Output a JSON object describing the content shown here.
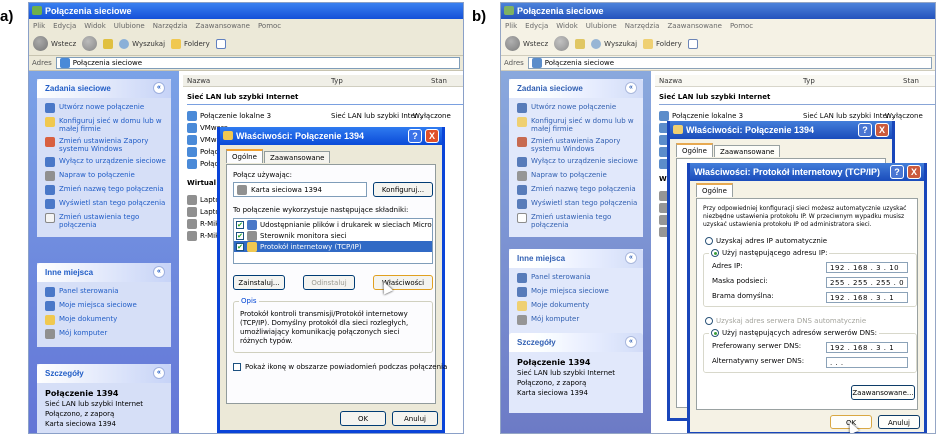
{
  "figure": {
    "panel_a_label": "a)",
    "panel_b_label": "b)"
  },
  "window": {
    "title": "Połączenia sieciowe",
    "menu": [
      "Plik",
      "Edycja",
      "Widok",
      "Ulubione",
      "Narzędzia",
      "Zaawansowane",
      "Pomoc"
    ],
    "toolbar": {
      "back": "Wstecz",
      "search": "Wyszukaj",
      "folders": "Foldery"
    },
    "address_label": "Adres",
    "address_value": "Połączenia sieciowe"
  },
  "sidebar": {
    "tasks": {
      "title": "Zadania sieciowe",
      "items": [
        {
          "label": "Utwórz nowe połączenie",
          "icon": "new-connection-icon"
        },
        {
          "label": "Konfiguruj sieć w domu lub w małej firmie",
          "icon": "home-network-icon"
        },
        {
          "label": "Zmień ustawienia Zapory systemu Windows",
          "icon": "firewall-icon"
        },
        {
          "label": "Wyłącz to urządzenie sieciowe",
          "icon": "disable-device-icon"
        },
        {
          "label": "Napraw to połączenie",
          "icon": "repair-icon"
        },
        {
          "label": "Zmień nazwę tego połączenia",
          "icon": "rename-icon"
        },
        {
          "label": "Wyświetl stan tego połączenia",
          "icon": "status-icon"
        },
        {
          "label": "Zmień ustawienia tego połączenia",
          "icon": "settings-icon"
        }
      ]
    },
    "places": {
      "title": "Inne miejsca",
      "items": [
        {
          "label": "Panel sterowania",
          "icon": "control-panel-icon"
        },
        {
          "label": "Moje miejsca sieciowe",
          "icon": "network-places-icon"
        },
        {
          "label": "Moje dokumenty",
          "icon": "documents-icon"
        },
        {
          "label": "Mój komputer",
          "icon": "computer-icon"
        }
      ]
    },
    "details": {
      "title": "Szczegóły",
      "name": "Połączenie 1394",
      "lines": [
        "Sieć LAN lub szybki Internet",
        "Połączono, z zaporą",
        "Karta sieciowa 1394"
      ]
    }
  },
  "list": {
    "columns": [
      "Nazwa",
      "Typ",
      "Stan"
    ],
    "group1": "Sieć LAN lub szybki Internet",
    "rows1": [
      {
        "name": "Połączenie lokalne 3",
        "type": "Sieć LAN lub szybki Inter...",
        "status": "Wyłączone"
      },
      {
        "name": "VMware...",
        "type": "",
        "status": ""
      },
      {
        "name": "VMware...",
        "type": "",
        "status": ""
      },
      {
        "name": "Połącz...",
        "type": "",
        "status": ""
      },
      {
        "name": "Połącz...",
        "type": "",
        "status": ""
      }
    ],
    "group2": "Wirtual",
    "rows2": [
      "Laptop",
      "Laptop",
      "R-Mik",
      "R-Mik"
    ]
  },
  "props": {
    "title": "Właściwości: Połączenie 1394",
    "tabs": [
      "Ogólne",
      "Zaawansowane"
    ],
    "connect_using_label": "Połącz używając:",
    "adapter": "Karta sieciowa 1394",
    "configure_button": "Konfiguruj...",
    "components_label": "To połączenie wykorzystuje następujące składniki:",
    "components": [
      "Udostępnianie plików i drukarek w sieciach Microsoft N",
      "Sterownik monitora sieci",
      "Protokół internetowy (TCP/IP)"
    ],
    "install_button": "Zainstaluj...",
    "uninstall_button": "Odinstaluj",
    "properties_button": "Właściwości",
    "description_label": "Opis",
    "description": "Protokół kontroli transmisji/Protokół internetowy (TCP/IP). Domyślny protokół dla sieci rozległych, umożliwiający komunikację połączonych sieci różnych typów.",
    "show_icon_label": "Pokaż ikonę w obszarze powiadomień podczas połączenia",
    "ok": "OK",
    "cancel": "Anuluj"
  },
  "tcpip": {
    "title": "Właściwości: Protokół internetowy (TCP/IP)",
    "tab": "Ogólne",
    "intro": "Przy odpowiedniej konfiguracji sieci możesz automatycznie uzyskać niezbędne ustawienia protokołu IP. W przeciwnym wypadku musisz uzyskać ustawienia protokołu IP od administratora sieci.",
    "auto_ip": "Uzyskaj adres IP automatycznie",
    "manual_ip": "Użyj następującego adresu IP:",
    "ip_label": "Adres IP:",
    "ip_value": "192 . 168 .  3  .  10",
    "mask_label": "Maska podsieci:",
    "mask_value": "255 . 255 . 255 .  0",
    "gateway_label": "Brama domyślna:",
    "gateway_value": "192 . 168 .  3  .  1",
    "auto_dns": "Uzyskaj adres serwera DNS automatycznie",
    "manual_dns": "Użyj następujących adresów serwerów DNS:",
    "dns1_label": "Preferowany serwer DNS:",
    "dns1_value": "192 . 168 .  3  .  1",
    "dns2_label": "Alternatywny serwer DNS:",
    "dns2_value": " .  .  .",
    "advanced_button": "Zaawansowane...",
    "ok": "OK",
    "cancel": "Anuluj"
  },
  "back_dialog_b": {
    "title": "Właściwości: Połączenie 1394",
    "tabs": [
      "Ogólne",
      "Zaawansowane"
    ]
  },
  "taskbar_icons": {
    "help": "?",
    "close": "X"
  }
}
